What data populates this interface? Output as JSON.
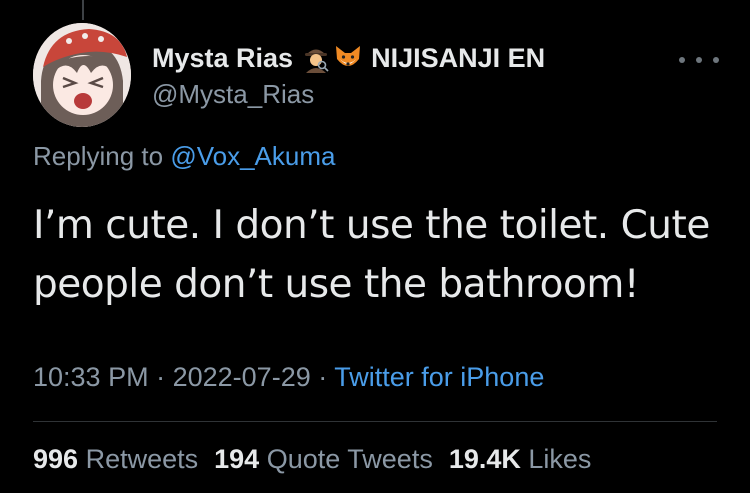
{
  "tweet": {
    "display_name": "Mysta Rias",
    "emoji_1": "detective-emoji",
    "emoji_2": "fox-emoji",
    "affiliation": "NIJISANJI EN",
    "handle": "@Mysta_Rias",
    "replying_prefix": "Replying to",
    "replying_to": "@Vox_Akuma",
    "text": "I’m cute. I don’t use the toilet. Cute people don’t use the bathroom!",
    "time": "10:33 PM",
    "separator": "·",
    "date": "2022-07-29",
    "source": "Twitter for iPhone"
  },
  "stats": {
    "retweets_count": "996",
    "retweets_label": "Retweets",
    "quotes_count": "194",
    "quotes_label": "Quote Tweets",
    "likes_count": "19.4K",
    "likes_label": "Likes"
  },
  "colors": {
    "background": "#000000",
    "text": "#e7e9ea",
    "muted": "#8b98a5",
    "link": "#4a9de9"
  }
}
